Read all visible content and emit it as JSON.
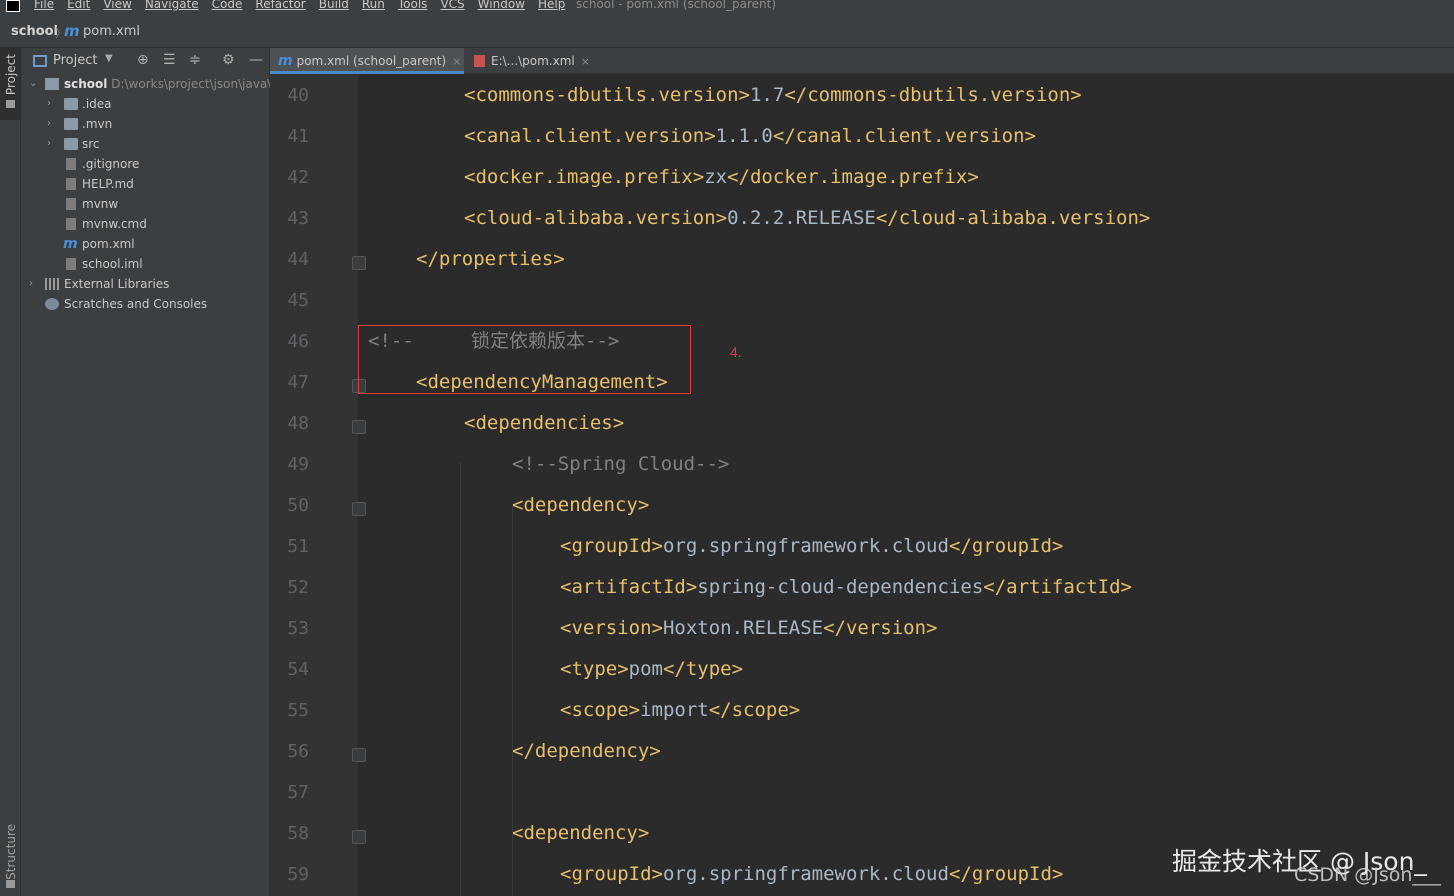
{
  "menubar": {
    "items": [
      "File",
      "Edit",
      "View",
      "Navigate",
      "Code",
      "Refactor",
      "Build",
      "Run",
      "Tools",
      "VCS",
      "Window",
      "Help"
    ],
    "window_title": "school - pom.xml (school_parent)"
  },
  "navbar": {
    "project": "school",
    "file": "pom.xml"
  },
  "toolstrip": {
    "project_label": "Project",
    "structure_label": "Structure"
  },
  "project_panel": {
    "title": "Project",
    "root": {
      "name": "school",
      "path": "D:\\works\\project\\json\\java\\"
    },
    "items": [
      {
        "label": ".idea",
        "type": "folder",
        "expandable": true
      },
      {
        "label": ".mvn",
        "type": "folder",
        "expandable": true
      },
      {
        "label": "src",
        "type": "folder",
        "expandable": true
      },
      {
        "label": ".gitignore",
        "type": "file"
      },
      {
        "label": "HELP.md",
        "type": "file"
      },
      {
        "label": "mvnw",
        "type": "file"
      },
      {
        "label": "mvnw.cmd",
        "type": "file"
      },
      {
        "label": "pom.xml",
        "type": "maven"
      },
      {
        "label": "school.iml",
        "type": "file"
      }
    ],
    "external_libraries": "External Libraries",
    "scratches": "Scratches and Consoles"
  },
  "tabs": [
    {
      "label": "pom.xml (school_parent)",
      "active": true
    },
    {
      "label": "E:\\...\\pom.xml",
      "active": false
    }
  ],
  "editor": {
    "lines": [
      {
        "num": "40",
        "indent": 2,
        "segments": [
          {
            "t": "tag",
            "v": "<commons-dbutils.version>"
          },
          {
            "t": "txt",
            "v": "1.7"
          },
          {
            "t": "tag",
            "v": "</commons-dbutils.version>"
          }
        ]
      },
      {
        "num": "41",
        "indent": 2,
        "segments": [
          {
            "t": "tag",
            "v": "<canal.client.version>"
          },
          {
            "t": "txt",
            "v": "1.1.0"
          },
          {
            "t": "tag",
            "v": "</canal.client.version>"
          }
        ]
      },
      {
        "num": "42",
        "indent": 2,
        "segments": [
          {
            "t": "tag",
            "v": "<docker.image.prefix>"
          },
          {
            "t": "txt",
            "v": "zx"
          },
          {
            "t": "tag",
            "v": "</docker.image.prefix>"
          }
        ]
      },
      {
        "num": "43",
        "indent": 2,
        "segments": [
          {
            "t": "tag",
            "v": "<cloud-alibaba.version>"
          },
          {
            "t": "txt",
            "v": "0.2.2.RELEASE"
          },
          {
            "t": "tag",
            "v": "</cloud-alibaba.version>"
          }
        ]
      },
      {
        "num": "44",
        "indent": 1,
        "fold": true,
        "segments": [
          {
            "t": "tag",
            "v": "</properties>"
          }
        ]
      },
      {
        "num": "45",
        "indent": 0,
        "segments": []
      },
      {
        "num": "46",
        "indent": 0,
        "segments": [
          {
            "t": "cmt",
            "v": "<!--     锁定依赖版本-->"
          }
        ]
      },
      {
        "num": "47",
        "indent": 1,
        "fold": true,
        "segments": [
          {
            "t": "tag",
            "v": "<dependencyManagement>"
          }
        ]
      },
      {
        "num": "48",
        "indent": 2,
        "fold": true,
        "segments": [
          {
            "t": "tag",
            "v": "<dependencies>"
          }
        ]
      },
      {
        "num": "49",
        "indent": 3,
        "segments": [
          {
            "t": "cmt",
            "v": "<!--Spring Cloud-->"
          }
        ]
      },
      {
        "num": "50",
        "indent": 3,
        "fold": true,
        "segments": [
          {
            "t": "tag",
            "v": "<dependency>"
          }
        ]
      },
      {
        "num": "51",
        "indent": 4,
        "segments": [
          {
            "t": "tag",
            "v": "<groupId>"
          },
          {
            "t": "txt",
            "v": "org.springframework.cloud"
          },
          {
            "t": "tag",
            "v": "</groupId>"
          }
        ]
      },
      {
        "num": "52",
        "indent": 4,
        "segments": [
          {
            "t": "tag",
            "v": "<artifactId>"
          },
          {
            "t": "txt",
            "v": "spring-cloud-dependencies"
          },
          {
            "t": "tag",
            "v": "</artifactId>"
          }
        ]
      },
      {
        "num": "53",
        "indent": 4,
        "segments": [
          {
            "t": "tag",
            "v": "<version>"
          },
          {
            "t": "txt",
            "v": "Hoxton.RELEASE"
          },
          {
            "t": "tag",
            "v": "</version>"
          }
        ]
      },
      {
        "num": "54",
        "indent": 4,
        "segments": [
          {
            "t": "tag",
            "v": "<type>"
          },
          {
            "t": "txt",
            "v": "pom"
          },
          {
            "t": "tag",
            "v": "</type>"
          }
        ]
      },
      {
        "num": "55",
        "indent": 4,
        "segments": [
          {
            "t": "tag",
            "v": "<scope>"
          },
          {
            "t": "txt",
            "v": "import"
          },
          {
            "t": "tag",
            "v": "</scope>"
          }
        ]
      },
      {
        "num": "56",
        "indent": 3,
        "fold": true,
        "segments": [
          {
            "t": "tag",
            "v": "</dependency>"
          }
        ]
      },
      {
        "num": "57",
        "indent": 0,
        "segments": []
      },
      {
        "num": "58",
        "indent": 3,
        "fold": true,
        "segments": [
          {
            "t": "tag",
            "v": "<dependency>"
          }
        ]
      },
      {
        "num": "59",
        "indent": 4,
        "segments": [
          {
            "t": "tag",
            "v": "<groupId>"
          },
          {
            "t": "txt",
            "v": "org.springframework.cloud"
          },
          {
            "t": "tag",
            "v": "</groupId>"
          }
        ]
      }
    ]
  },
  "annotation": {
    "label": "4.",
    "color": "#e03c3c"
  },
  "watermarks": {
    "juejin": "掘金技术社区 @ Json_",
    "csdn": "CSDN @Json___"
  },
  "colors": {
    "tag": "#e8bf6a",
    "text": "#a9b7c6",
    "comment": "#808080",
    "line_number": "#606366"
  }
}
